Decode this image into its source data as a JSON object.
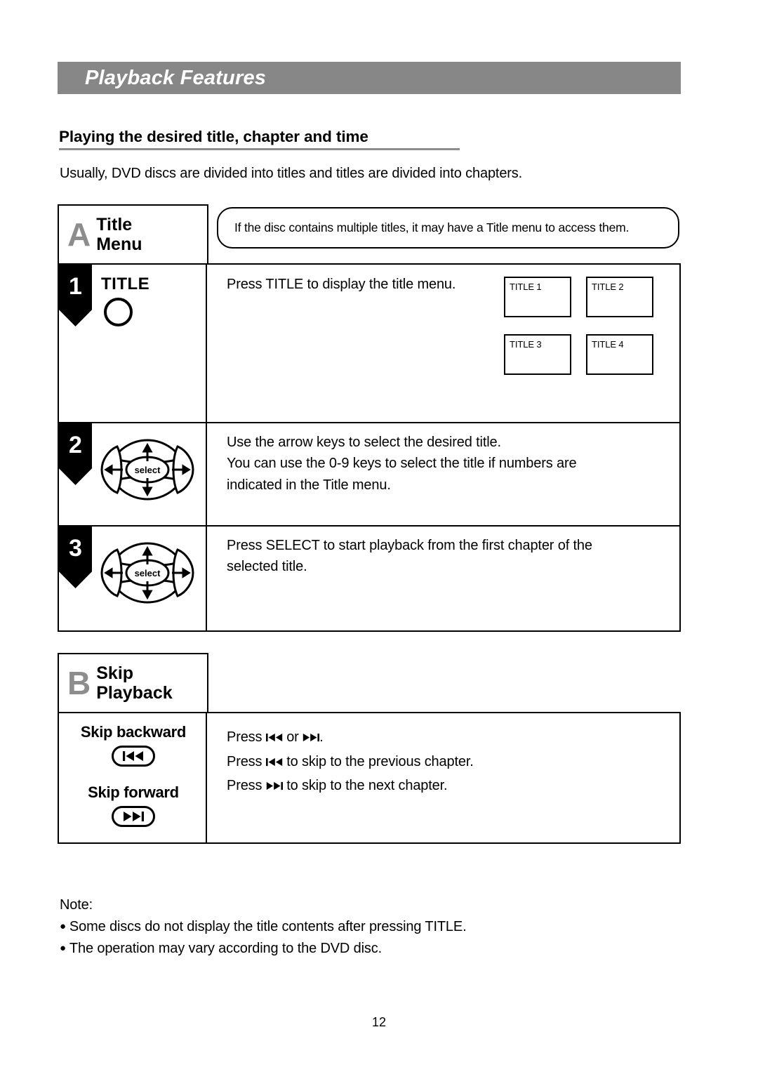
{
  "page": {
    "header_title": "Playback Features",
    "section_heading": "Playing the desired title, chapter and time",
    "intro": "Usually, DVD discs are divided into titles and titles are divided into chapters.",
    "page_number": "12",
    "colors": {
      "header_bar": "#878787",
      "header_text": "#ffffff",
      "section_letter": "#8d8d8d",
      "rule": "#8d8d8d",
      "ink": "#000000",
      "paper": "#ffffff"
    }
  },
  "section_a": {
    "letter": "A",
    "name_line1": "Title",
    "name_line2": "Menu",
    "callout": "If the disc contains multiple titles, it may have a Title menu to access them.",
    "steps": [
      {
        "number": "1",
        "key_label": "TITLE",
        "key_icon": "round-button-icon",
        "text": "Press TITLE to display the title menu.",
        "title_menu": {
          "boxes": [
            "TITLE 1",
            "TITLE 2",
            "TITLE 3",
            "TITLE 4"
          ]
        }
      },
      {
        "number": "2",
        "key_icon": "dpad-select-icon",
        "dpad_center_label": "select",
        "text_lines": [
          "Use the arrow keys to select the desired title.",
          "You can use the 0-9 keys to select the title if numbers are",
          "indicated in the Title menu."
        ]
      },
      {
        "number": "3",
        "key_icon": "dpad-select-icon",
        "dpad_center_label": "select",
        "text_lines": [
          "Press SELECT to start playback from the first chapter of the",
          "selected title."
        ]
      }
    ]
  },
  "section_b": {
    "letter": "B",
    "name_line1": "Skip",
    "name_line2": "Playback",
    "keys": [
      {
        "label": "Skip backward",
        "icon": "skip-backward-icon",
        "glyph": "◀◀"
      },
      {
        "label": "Skip forward",
        "icon": "skip-forward-icon",
        "glyph": "▶▶"
      }
    ],
    "lines": [
      {
        "pre": "Press ",
        "icon1": "skip-backward-icon",
        "mid": " or ",
        "icon2": "skip-forward-icon",
        "post": "."
      },
      {
        "pre": "Press ",
        "icon1": "skip-backward-icon",
        "post": " to skip to the previous chapter."
      },
      {
        "pre": "Press ",
        "icon1": "skip-forward-icon",
        "post": " to skip to the next chapter."
      }
    ]
  },
  "notes": {
    "label": "Note:",
    "items": [
      "Some discs do not display the title contents after pressing TITLE.",
      "The operation may vary according to the DVD disc."
    ]
  }
}
